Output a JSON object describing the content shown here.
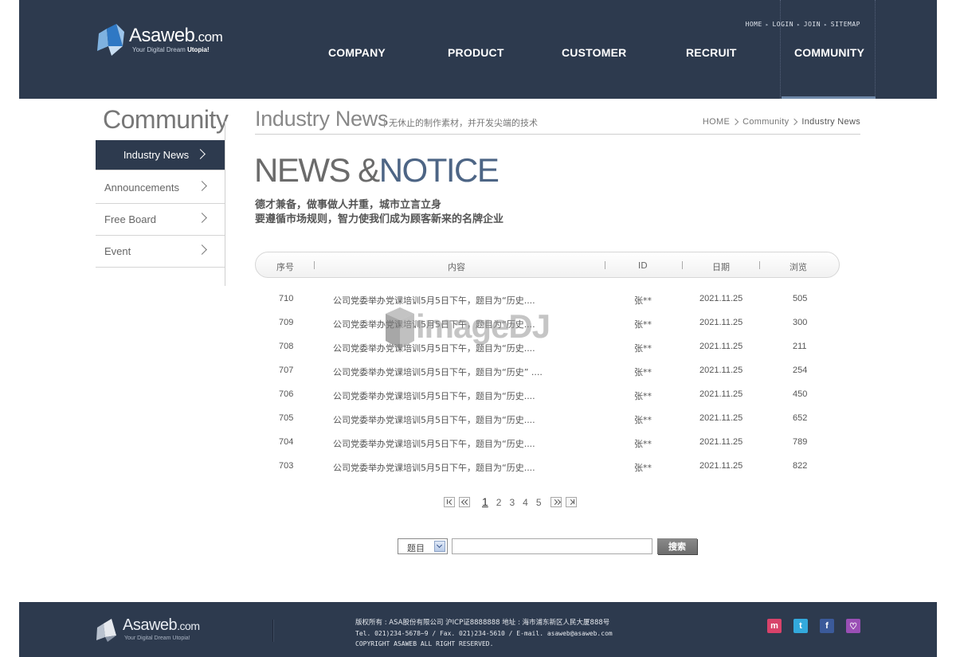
{
  "header": {
    "logo_text": "Asaweb",
    "logo_suffix": ".com",
    "logo_tag_prefix": "Your Digital Dream ",
    "logo_tag_emph": "Utopia!",
    "util_nav": [
      "HOME",
      "LOGIN",
      "JOIN",
      "SITEMAP"
    ],
    "gnb": [
      "COMPANY",
      "PRODUCT",
      "CUSTOMER",
      "RECRUIT",
      "COMMUNITY"
    ],
    "active_gnb": "COMMUNITY"
  },
  "sidebar": {
    "title": "Community",
    "items": [
      {
        "label": "Industry News",
        "active": true
      },
      {
        "label": "Announcements",
        "active": false
      },
      {
        "label": "Free Board",
        "active": false
      },
      {
        "label": "Event",
        "active": false
      }
    ]
  },
  "content": {
    "page_title": "Industry News",
    "page_subtitle": "无休止的制作素材，并开发尖端的技术",
    "breadcrumb": [
      "HOME",
      "Community",
      "Industry News"
    ],
    "hero_title_part1": "NEWS &",
    "hero_title_part2": "NOTICE",
    "hero_line1": "德才兼备，做事做人并重，城市立言立身",
    "hero_line2": "要遵循市场规则，智力使我们成为顾客新来的名牌企业"
  },
  "table": {
    "headers": {
      "no": "序号",
      "title": "内容",
      "id": "ID",
      "date": "日期",
      "views": "浏览"
    },
    "rows": [
      {
        "no": "710",
        "title": "公司党委举办党课培训5月5日下午，题目为“历史....",
        "id": "张**",
        "date": "2021.11.25",
        "views": "505"
      },
      {
        "no": "709",
        "title": "公司党委举办党课培训5月5日下午，题目为“历史....",
        "id": "张**",
        "date": "2021.11.25",
        "views": "300"
      },
      {
        "no": "708",
        "title": "公司党委举办党课培训5月5日下午，题目为“历史....",
        "id": "张**",
        "date": "2021.11.25",
        "views": "211"
      },
      {
        "no": "707",
        "title": "公司党委举办党课培训5月5日下午，题目为“历史” ....",
        "id": "张**",
        "date": "2021.11.25",
        "views": "254"
      },
      {
        "no": "706",
        "title": "公司党委举办党课培训5月5日下午，题目为“历史....",
        "id": "张**",
        "date": "2021.11.25",
        "views": "450"
      },
      {
        "no": "705",
        "title": "公司党委举办党课培训5月5日下午，题目为“历史....",
        "id": "张**",
        "date": "2021.11.25",
        "views": "652"
      },
      {
        "no": "704",
        "title": "公司党委举办党课培训5月5日下午，题目为“历史....",
        "id": "张**",
        "date": "2021.11.25",
        "views": "789"
      },
      {
        "no": "703",
        "title": "公司党委举办党课培训5月5日下午，题目为“历史....",
        "id": "张**",
        "date": "2021.11.25",
        "views": "822"
      }
    ]
  },
  "watermark": "imageDJ",
  "pagination": {
    "pages": [
      "1",
      "2",
      "3",
      "4",
      "5"
    ],
    "current": "1"
  },
  "search": {
    "select_value": "题目",
    "input_value": "",
    "button_label": "搜索"
  },
  "footer": {
    "logo_text": "Asaweb",
    "logo_suffix": ".com",
    "logo_tag": "Your Digital Dream Utopia!",
    "line1": "版权所有 : ASA股份有限公司 沪ICP证8888888   地址 : 海市浦东新区人民大厦888号",
    "line2": "Tel. 021)234-5678~9  / Fax. 021)234-5610  / E-mail. asaweb@asaweb.com",
    "line3": "COPYRIGHT ASAWEB ALL RIGHT RESERVED.",
    "social": [
      {
        "name": "me2day-icon",
        "color": "#d8426a",
        "glyph": "m"
      },
      {
        "name": "twitter-icon",
        "color": "#33a9dc",
        "glyph": "t"
      },
      {
        "name": "facebook-icon",
        "color": "#3b5a9a",
        "glyph": "f"
      },
      {
        "name": "chat-icon",
        "color": "#9a4fb5",
        "glyph": "♡"
      }
    ]
  },
  "colors": {
    "header_bg": "#2d3a4e",
    "accent_blue": "#4d6585",
    "active_underline": "#6e88a8"
  }
}
